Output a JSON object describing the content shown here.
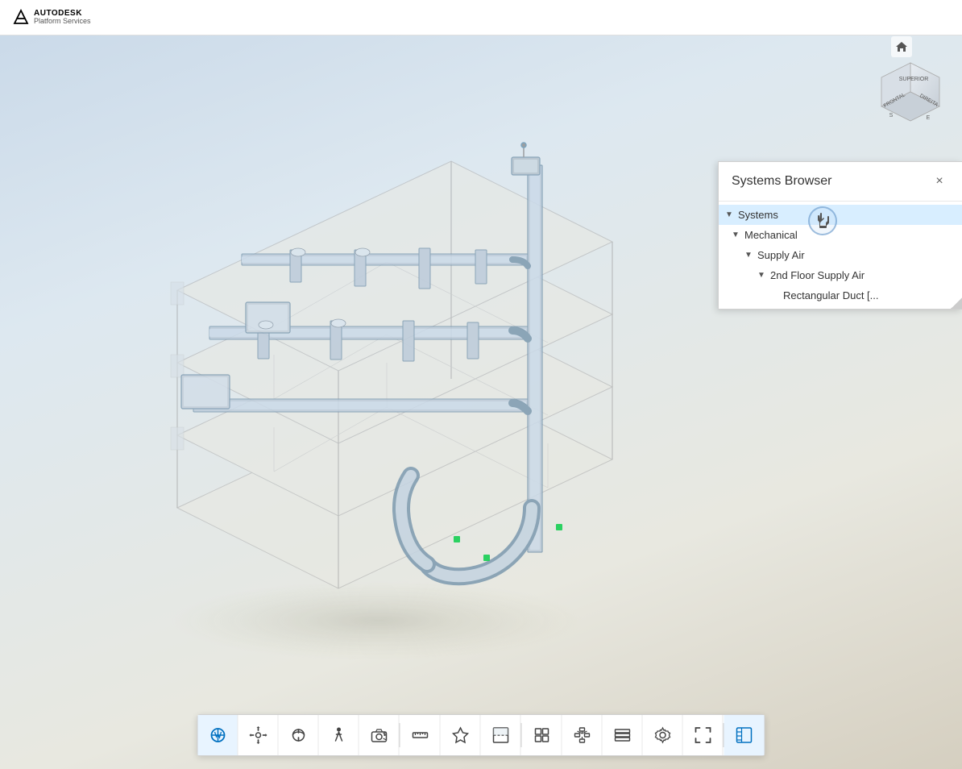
{
  "app": {
    "name": "AUTODESK",
    "platform": "Platform Services"
  },
  "header": {
    "logo_text": "AUTODESK",
    "logo_subtitle": "Platform Services"
  },
  "viewcube": {
    "labels": {
      "top": "SUPERIOR",
      "front": "FRONTAL",
      "right": "DIREITA",
      "south": "S",
      "east": "E"
    }
  },
  "systems_browser": {
    "title": "Systems Browser",
    "close_label": "×",
    "tree": [
      {
        "id": "systems",
        "label": "Systems",
        "level": 0,
        "arrow": "down",
        "selected": true
      },
      {
        "id": "mechanical",
        "label": "Mechanical",
        "level": 1,
        "arrow": "down",
        "selected": false
      },
      {
        "id": "supply-air",
        "label": "Supply Air",
        "level": 2,
        "arrow": "down",
        "selected": false
      },
      {
        "id": "2nd-floor-supply-air",
        "label": "2nd Floor Supply Air",
        "level": 3,
        "arrow": "down",
        "selected": false
      },
      {
        "id": "rectangular-duct",
        "label": "Rectangular Duct [...",
        "level": 4,
        "arrow": "none",
        "selected": false
      }
    ]
  },
  "toolbar": {
    "buttons": [
      {
        "id": "select",
        "icon": "⊕",
        "label": "Select",
        "active": true
      },
      {
        "id": "pan",
        "icon": "✋",
        "label": "Pan",
        "active": false
      },
      {
        "id": "orbit",
        "icon": "↕",
        "label": "Orbit",
        "active": false
      },
      {
        "id": "walk",
        "icon": "🚶",
        "label": "Walk",
        "active": false
      },
      {
        "id": "camera",
        "icon": "📷",
        "label": "Camera",
        "active": false
      },
      {
        "id": "measure",
        "icon": "📏",
        "label": "Measure",
        "active": false
      },
      {
        "id": "explode",
        "icon": "⬡",
        "label": "Explode",
        "active": false
      },
      {
        "id": "section",
        "icon": "⬜",
        "label": "Section",
        "active": false
      },
      {
        "id": "model-browser",
        "icon": "⬒",
        "label": "Model Browser",
        "active": false
      },
      {
        "id": "hierarchy",
        "icon": "⊞",
        "label": "Hierarchy",
        "active": false
      },
      {
        "id": "layers",
        "icon": "⊟",
        "label": "Layers",
        "active": false
      },
      {
        "id": "settings",
        "icon": "⚙",
        "label": "Settings",
        "active": false
      },
      {
        "id": "fullscreen",
        "icon": "⛶",
        "label": "Fullscreen",
        "active": false
      },
      {
        "id": "systems-btn",
        "icon": "⊞",
        "label": "Systems",
        "active": true
      }
    ]
  }
}
